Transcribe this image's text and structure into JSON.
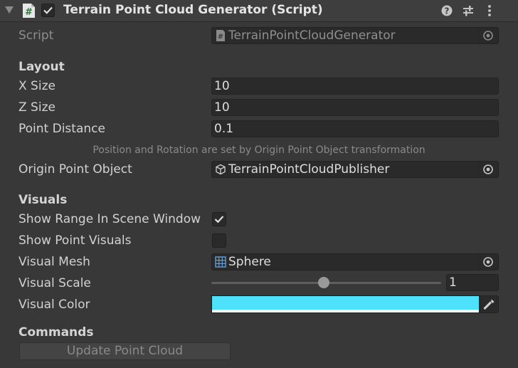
{
  "header": {
    "script_icon_glyph": "#",
    "title": "Terrain Point Cloud Generator (Script)",
    "enabled": true,
    "icons": [
      "help-icon",
      "preset-sliders-icon",
      "kebab-menu-icon"
    ]
  },
  "script_field": {
    "label": "Script",
    "value": "TerrainPointCloudGenerator",
    "icon": "script-file-icon"
  },
  "layout": {
    "heading": "Layout",
    "x_size_label": "X Size",
    "x_size_value": "10",
    "z_size_label": "Z Size",
    "z_size_value": "10",
    "point_distance_label": "Point Distance",
    "point_distance_value": "0.1",
    "note": "Position and Rotation are set by Origin Point Object transformation",
    "origin_label": "Origin Point Object",
    "origin_value": "TerrainPointCloudPublisher",
    "origin_icon": "gameobject-cube-icon"
  },
  "visuals": {
    "heading": "Visuals",
    "show_range_label": "Show Range In Scene Window",
    "show_range_checked": true,
    "show_points_label": "Show Point Visuals",
    "show_points_checked": false,
    "mesh_label": "Visual Mesh",
    "mesh_value": "Sphere",
    "mesh_icon": "mesh-grid-icon",
    "scale_label": "Visual Scale",
    "scale_value": "1",
    "scale_slider_fraction": 0.49,
    "color_label": "Visual Color",
    "color_hex": "#4de1fb",
    "color_alpha_bar": "#ffffff"
  },
  "commands": {
    "heading": "Commands",
    "update_button": "Update Point Cloud"
  },
  "colors": {
    "background": "#383838",
    "field": "#2a2a2a",
    "text": "#d2d2d2",
    "dim_text": "#8d8d8d"
  }
}
